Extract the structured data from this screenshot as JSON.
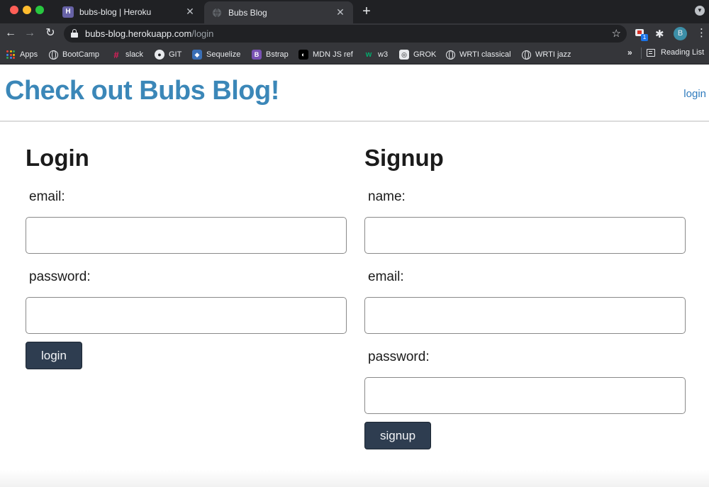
{
  "browser": {
    "tabs": [
      {
        "title": "bubs-blog | Heroku",
        "favicon": "heroku-icon",
        "active": false
      },
      {
        "title": "Bubs Blog",
        "favicon": "globe-icon",
        "active": true
      }
    ],
    "new_tab_label": "+",
    "address": {
      "domain": "bubs-blog.herokuapp.com",
      "path": "/login"
    },
    "profile_initial": "B",
    "extension_badge": "1",
    "bookmarks": [
      {
        "label": "Apps",
        "icon": "apps-grid-icon"
      },
      {
        "label": "BootCamp",
        "icon": "globe-icon"
      },
      {
        "label": "slack",
        "icon": "slack-icon"
      },
      {
        "label": "GIT",
        "icon": "github-icon"
      },
      {
        "label": "Sequelize",
        "icon": "sequelize-icon"
      },
      {
        "label": "Bstrap",
        "icon": "bootstrap-icon"
      },
      {
        "label": "MDN JS ref",
        "icon": "mdn-icon"
      },
      {
        "label": "w3",
        "icon": "w3-icon"
      },
      {
        "label": "GROK",
        "icon": "grok-icon"
      },
      {
        "label": "WRTI classical",
        "icon": "globe-icon"
      },
      {
        "label": "WRTI jazz",
        "icon": "globe-icon"
      }
    ],
    "overflow_label": "»",
    "reading_list_label": "Reading List"
  },
  "site": {
    "title": "Check out Bubs Blog!",
    "login_link": "login"
  },
  "login_form": {
    "heading": "Login",
    "email_label": "email:",
    "email_value": "",
    "password_label": "password:",
    "password_value": "",
    "submit_label": "login"
  },
  "signup_form": {
    "heading": "Signup",
    "name_label": "name:",
    "name_value": "",
    "email_label": "email:",
    "email_value": "",
    "password_label": "password:",
    "password_value": "",
    "submit_label": "signup"
  },
  "colors": {
    "title": "#3b87b8",
    "link": "#2f7bbd",
    "button_bg": "#2e3d50",
    "chrome_dark": "#202124",
    "chrome_toolbar": "#35363a"
  }
}
